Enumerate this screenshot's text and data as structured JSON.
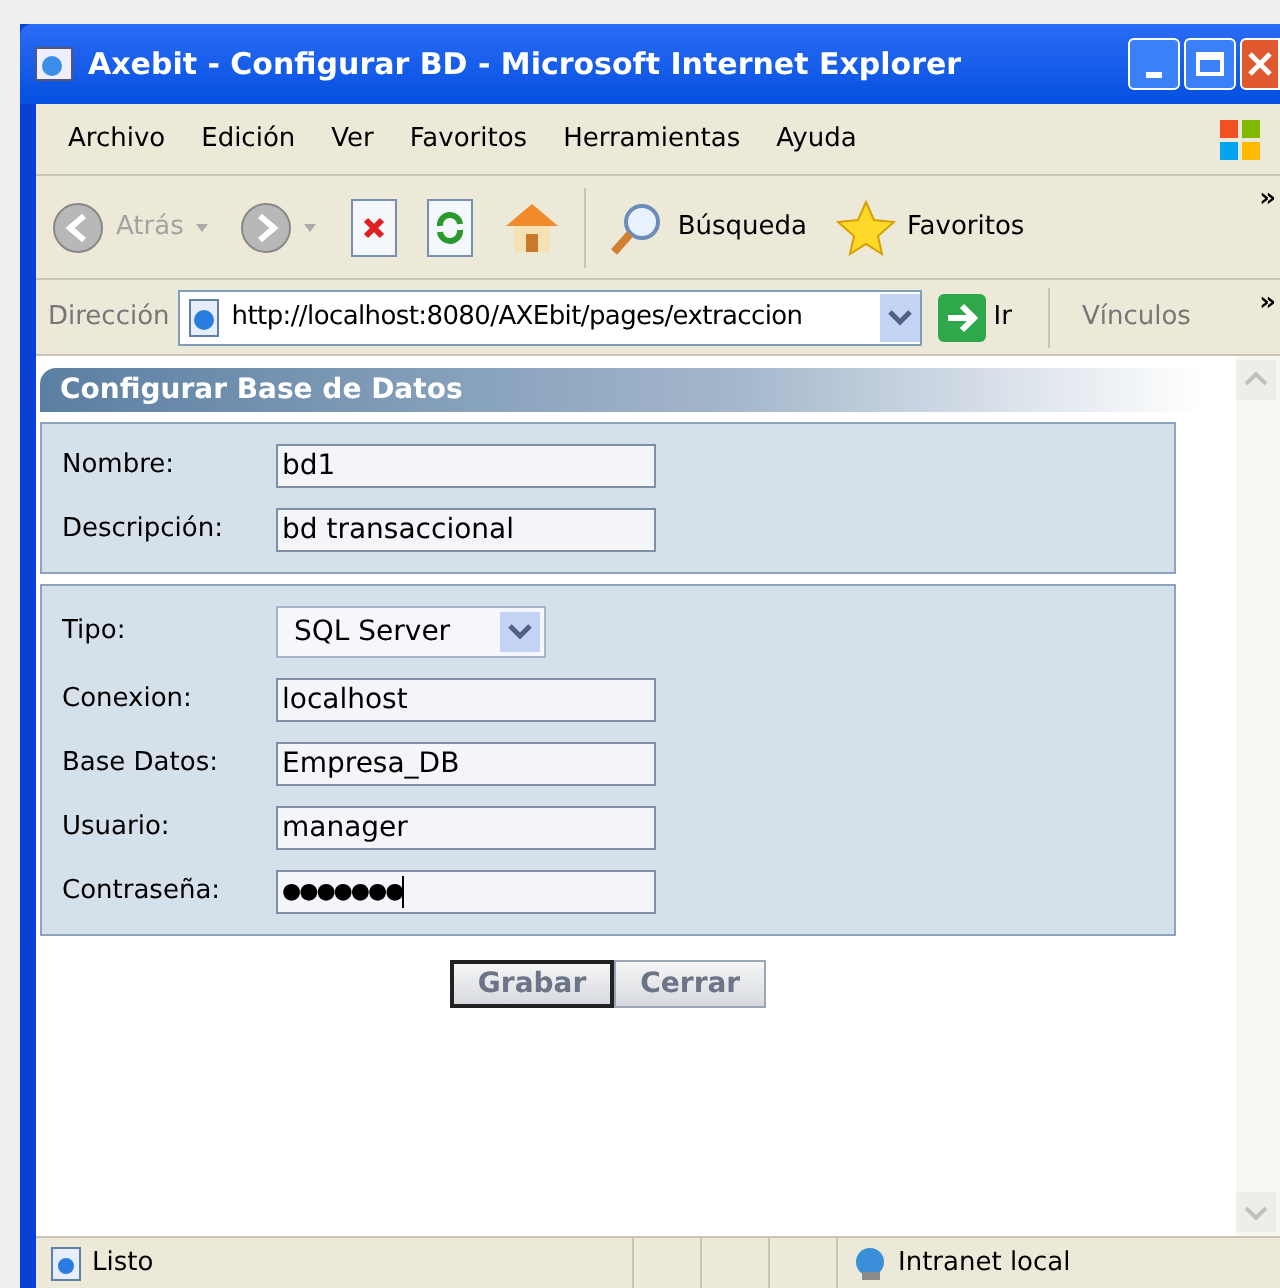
{
  "window": {
    "title": "Axebit - Configurar BD - Microsoft Internet Explorer"
  },
  "menu": [
    {
      "label": "Archivo"
    },
    {
      "label": "Edición"
    },
    {
      "label": "Ver"
    },
    {
      "label": "Favoritos"
    },
    {
      "label": "Herramientas"
    },
    {
      "label": "Ayuda"
    }
  ],
  "toolbar": {
    "back": {
      "label": "Atrás",
      "disabled": true
    },
    "search": "Búsqueda",
    "favorites": "Favoritos",
    "more": "»"
  },
  "address_bar": {
    "label": "Dirección",
    "url": "http://localhost:8080/AXEbit/pages/extraccion",
    "go": "Ir",
    "links": "Vínculos",
    "more": "»"
  },
  "form": {
    "title": "Configurar Base de Datos",
    "sections": [
      {
        "fields": [
          {
            "kind": "text",
            "label": "Nombre:",
            "value": "bd1"
          },
          {
            "kind": "text",
            "label": "Descripción:",
            "value": "bd transaccional"
          }
        ]
      },
      {
        "fields": [
          {
            "kind": "select",
            "label": "Tipo:",
            "value": "SQL Server"
          },
          {
            "kind": "text",
            "label": "Conexion:",
            "value": "localhost"
          },
          {
            "kind": "text",
            "label": "Base Datos:",
            "value": "Empresa_DB"
          },
          {
            "kind": "text",
            "label": "Usuario:",
            "value": "manager"
          },
          {
            "kind": "password",
            "label": "Contraseña:",
            "value": "●●●●●●●",
            "focused": true
          }
        ]
      }
    ],
    "buttons": [
      {
        "label": "Grabar",
        "selected": true
      },
      {
        "label": "Cerrar",
        "selected": false
      }
    ]
  },
  "status_bar": {
    "text": "Listo",
    "zone": "Intranet local"
  }
}
